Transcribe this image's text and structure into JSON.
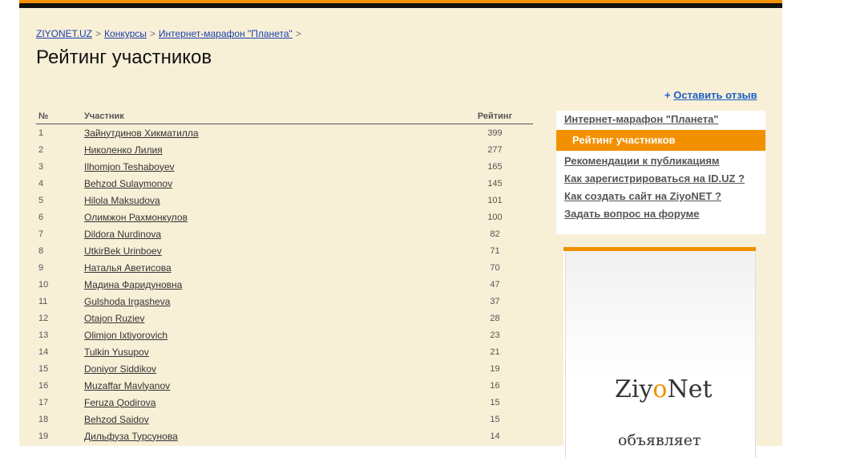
{
  "breadcrumb": [
    "ZIYONET.UZ",
    "Конкурсы",
    "Интернет-марафон \"Планета\""
  ],
  "breadcrumb_sep": ">",
  "page_title": "Рейтинг участников",
  "feedback": {
    "plus": "+",
    "label": "Оставить отзыв"
  },
  "table": {
    "headers": {
      "num": "№",
      "participant": "Участник",
      "rating": "Рейтинг"
    },
    "rows": [
      {
        "num": "1",
        "name": "Зайнутдинов Хикматилла",
        "rating": "399"
      },
      {
        "num": "2",
        "name": "Николенко Лилия",
        "rating": "277"
      },
      {
        "num": "3",
        "name": "Ilhomjon Teshaboyev",
        "rating": "165"
      },
      {
        "num": "4",
        "name": "Behzod Sulaymonov",
        "rating": "145"
      },
      {
        "num": "5",
        "name": "Hilola Maksudova",
        "rating": "101"
      },
      {
        "num": "6",
        "name": "Олимжон Рахмонкулов",
        "rating": "100"
      },
      {
        "num": "7",
        "name": "Dildora Nurdinova",
        "rating": "82"
      },
      {
        "num": "8",
        "name": "UtkirBek Urinboev",
        "rating": "71"
      },
      {
        "num": "9",
        "name": "Наталья Аветисова",
        "rating": "70"
      },
      {
        "num": "10",
        "name": "Мадина Фаридуновна",
        "rating": "47"
      },
      {
        "num": "11",
        "name": "Gulshoda Irgasheva",
        "rating": "37"
      },
      {
        "num": "12",
        "name": "Otajon Ruziev",
        "rating": "28"
      },
      {
        "num": "13",
        "name": "Olimjon Ixtiyorovich",
        "rating": "23"
      },
      {
        "num": "14",
        "name": "Tulkin Yusupov",
        "rating": "21"
      },
      {
        "num": "15",
        "name": "Doniyor Siddikov",
        "rating": "19"
      },
      {
        "num": "16",
        "name": "Muzaffar Mavlyanov",
        "rating": "16"
      },
      {
        "num": "17",
        "name": "Feruza Qodirova",
        "rating": "15"
      },
      {
        "num": "18",
        "name": "Behzod Saidov",
        "rating": "15"
      },
      {
        "num": "19",
        "name": "Дильфуза Турсунова",
        "rating": "14"
      }
    ]
  },
  "sidebar_menu": [
    {
      "label": "Интернет-марафон \"Планета\"",
      "active": false
    },
    {
      "label": "Рейтинг участников",
      "active": true
    },
    {
      "label": "Рекомендации к публикациям",
      "active": false
    },
    {
      "label": "Как зарегистрироваться на ID.UZ ?",
      "active": false
    },
    {
      "label": "Как создать сайт на ZiyoNET ?",
      "active": false
    },
    {
      "label": "Задать вопрос на форуме",
      "active": false
    }
  ],
  "banner": {
    "logo_pre": "Ziy",
    "logo_o": "o",
    "logo_post": "Net",
    "slogan": "объявляет"
  },
  "colors": {
    "accent": "#f29100",
    "background": "#f8efd7",
    "link": "#1a3fae"
  }
}
